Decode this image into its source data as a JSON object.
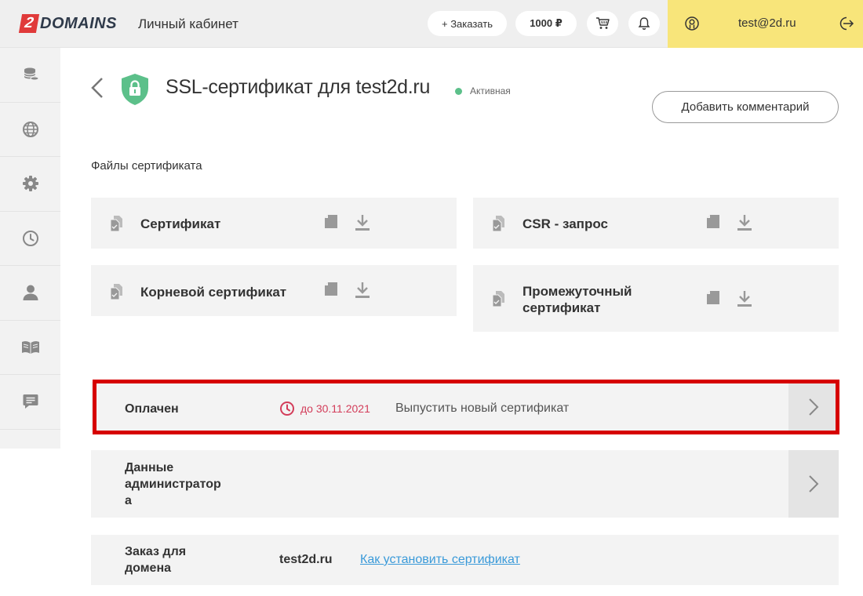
{
  "header": {
    "logo_number": "2",
    "logo_text": "DOMAINS",
    "cabinet_label": "Личный кабинет",
    "order_button": "+ Заказать",
    "balance": "1000 ₽",
    "cart_icon": "cart-icon",
    "bell_icon": "bell-icon",
    "user_email": "test@2d.ru"
  },
  "sidebar": {
    "items": [
      {
        "icon": "coins-icon"
      },
      {
        "icon": "globe-icon"
      },
      {
        "icon": "gear-icon"
      },
      {
        "icon": "history-icon"
      },
      {
        "icon": "user-icon"
      },
      {
        "icon": "book-icon"
      },
      {
        "icon": "chat-icon"
      }
    ]
  },
  "page": {
    "title": "SSL-сертификат для test2d.ru",
    "status": "Активная",
    "status_color": "#5cc08a",
    "comment_button": "Добавить комментарий",
    "files_label": "Файлы сертификата"
  },
  "files": [
    {
      "name": "Сертификат"
    },
    {
      "name": "CSR - запрос"
    },
    {
      "name": "Корневой сертификат"
    },
    {
      "name_line1": "Промежуточный",
      "name_line2": "сертификат"
    }
  ],
  "rows": {
    "paid": {
      "label": "Оплачен",
      "date": "до 30.11.2021",
      "date_color": "#d33d5a",
      "action": "Выпустить новый сертификат"
    },
    "admin": {
      "label_line1": "Данные",
      "label_line2": "администратор",
      "label_line3": "а"
    },
    "domain": {
      "label_line1": "Заказ для",
      "label_line2": "домена",
      "value": "test2d.ru",
      "link": "Как установить сертификат"
    }
  },
  "colors": {
    "accent_yellow": "#f8e57a",
    "brand_red": "#e03a3a",
    "highlight_red": "#d60000",
    "link_blue": "#3a9ad9",
    "shield_green": "#5cc08a"
  }
}
